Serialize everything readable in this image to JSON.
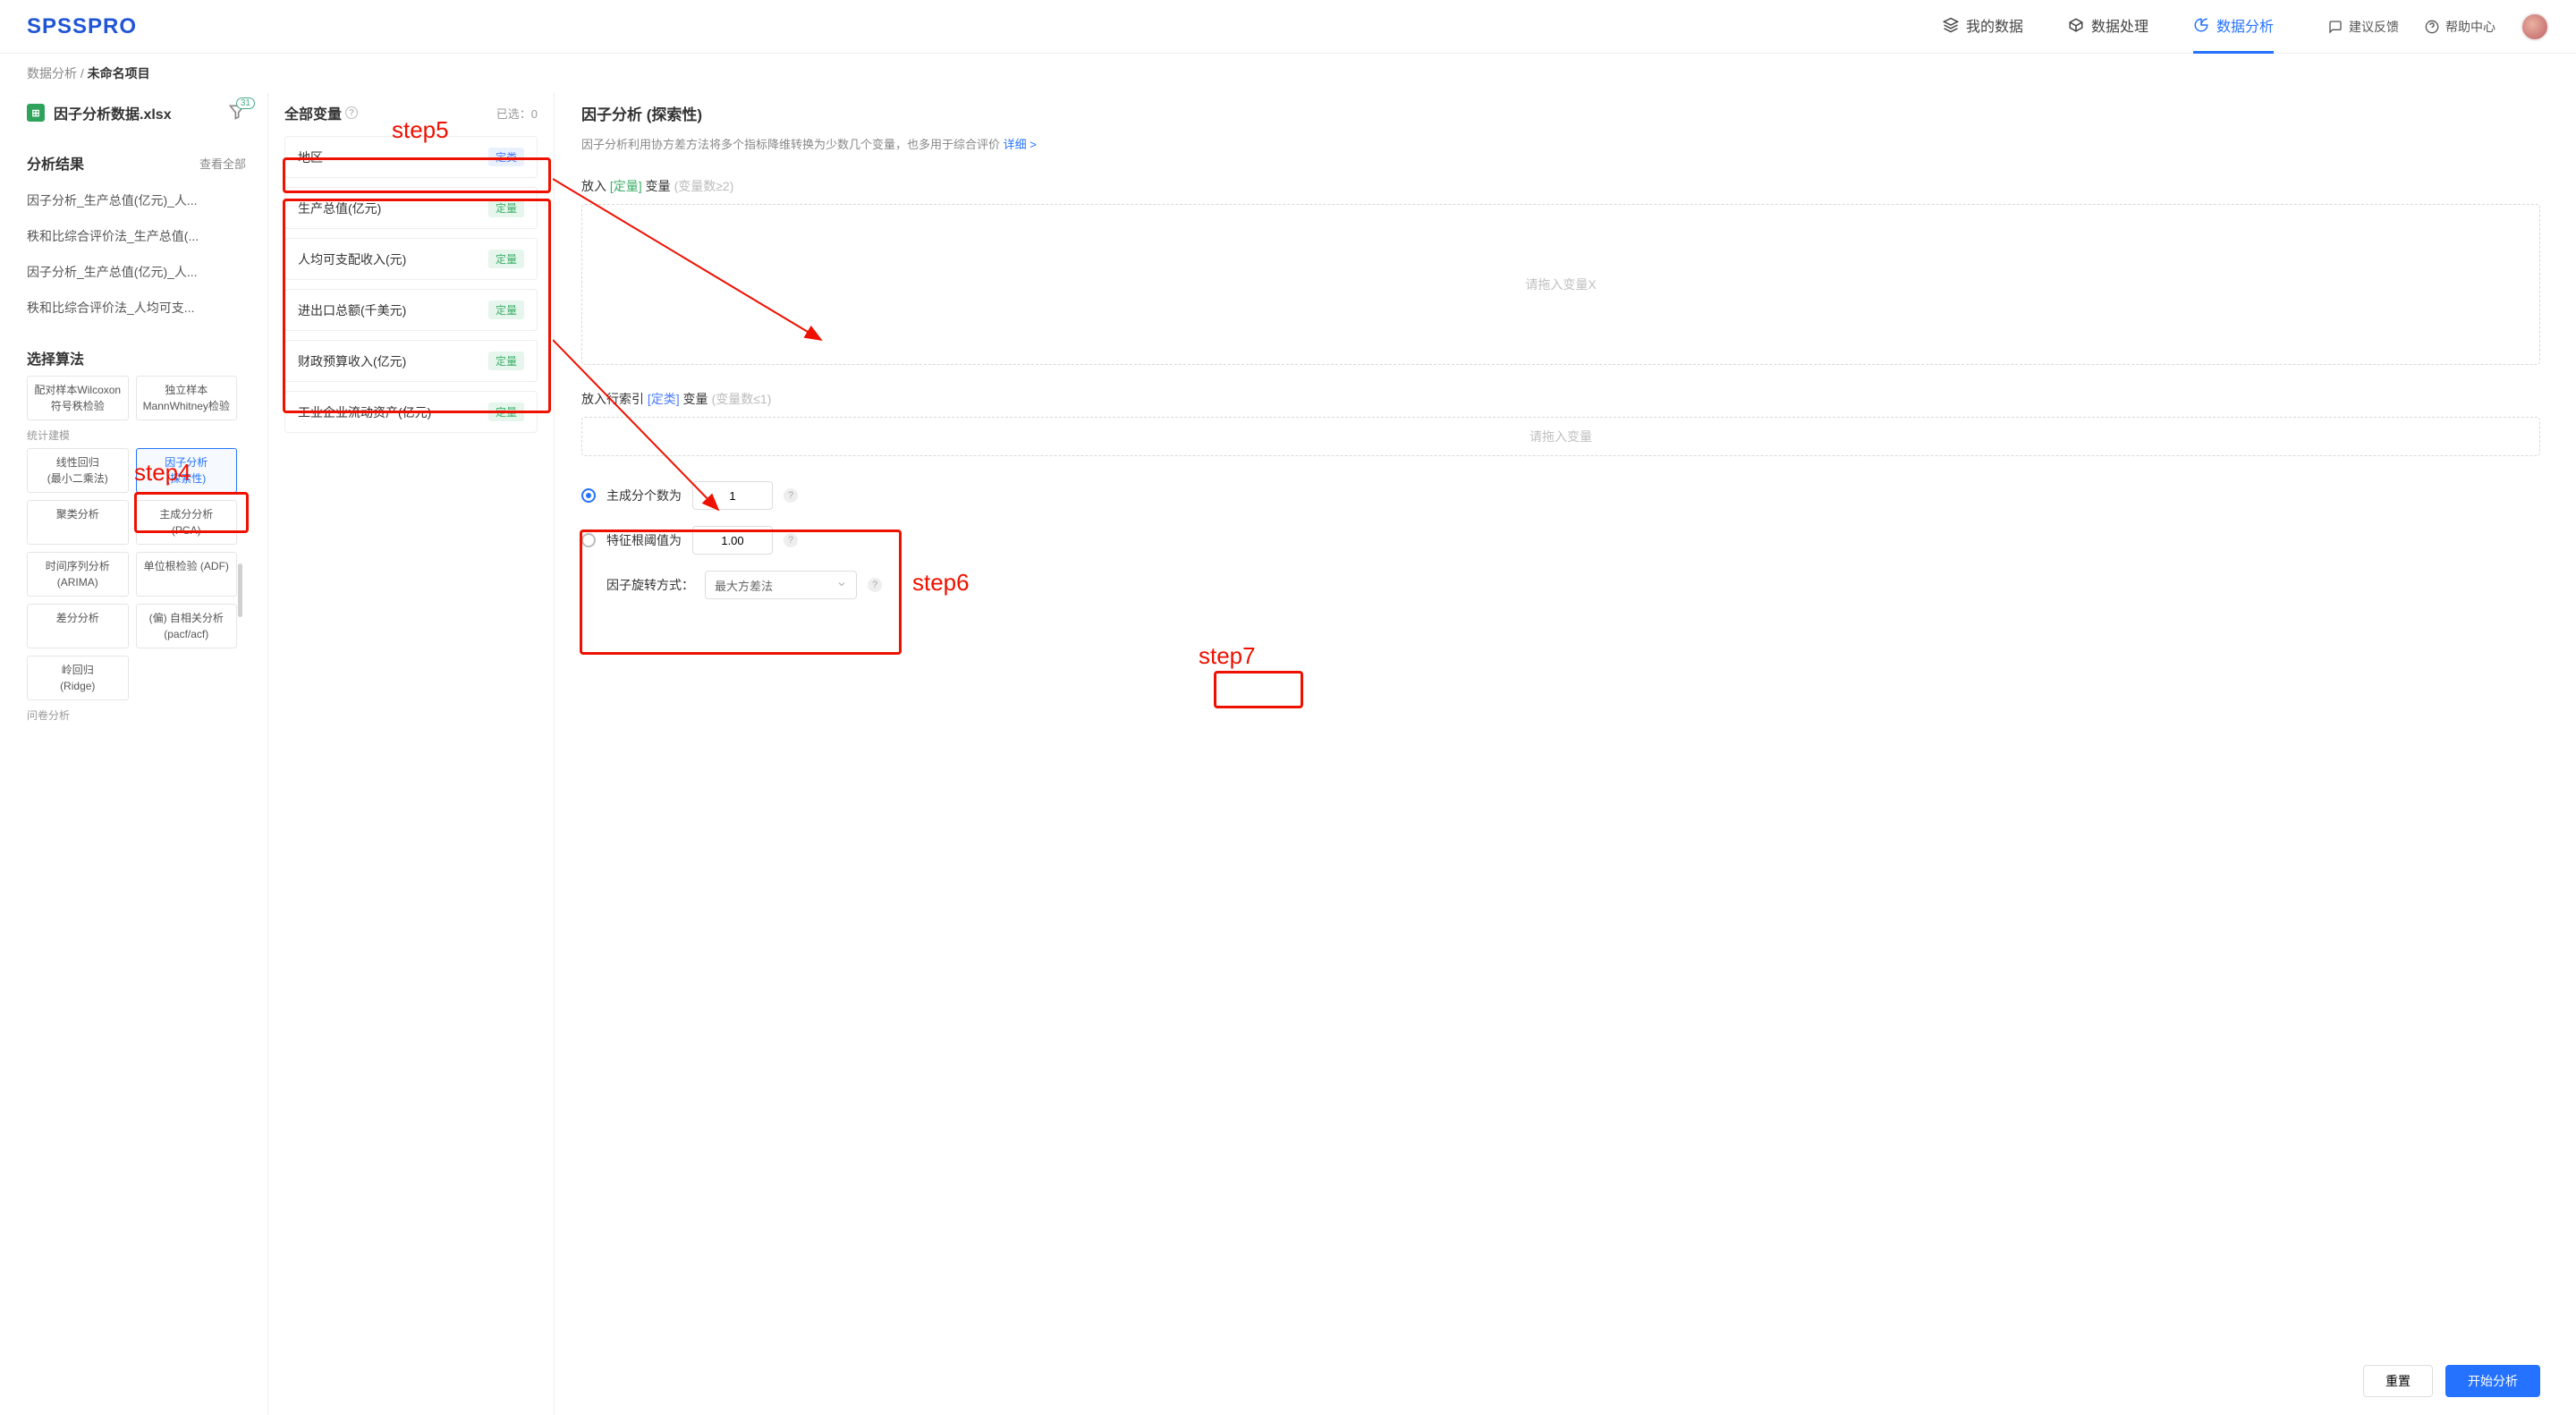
{
  "brand": "SPSSPRO",
  "top_nav": {
    "my_data": "我的数据",
    "data_process": "数据处理",
    "data_analysis": "数据分析",
    "feedback": "建议反馈",
    "help": "帮助中心"
  },
  "breadcrumb": {
    "root": "数据分析",
    "sep": " / ",
    "current": "未命名项目"
  },
  "file": {
    "name": "因子分析数据.xlsx",
    "filter_count": "31"
  },
  "left": {
    "results_title": "分析结果",
    "results_view_all": "查看全部",
    "results": [
      "因子分析_生产总值(亿元)_人...",
      "秩和比综合评价法_生产总值(...",
      "因子分析_生产总值(亿元)_人...",
      "秩和比综合评价法_人均可支..."
    ],
    "algo_title": "选择算法",
    "cat_stat": "统计建模",
    "cat_survey": "问卷分析",
    "algos_top": [
      {
        "l1": "配对样本Wilcoxon",
        "l2": "符号秩检验"
      },
      {
        "l1": "独立样本",
        "l2": "MannWhitney检验"
      }
    ],
    "algos_grid": [
      {
        "l1": "线性回归",
        "l2": "(最小二乘法)"
      },
      {
        "l1": "因子分析",
        "l2": "(探索性)",
        "active": true
      },
      {
        "l1": "聚类分析",
        "l2": ""
      },
      {
        "l1": "主成分分析",
        "l2": "(PCA)"
      },
      {
        "l1": "时间序列分析",
        "l2": "(ARIMA)"
      },
      {
        "l1": "单位根检验 (ADF)",
        "l2": ""
      },
      {
        "l1": "差分分析",
        "l2": ""
      },
      {
        "l1": "(偏) 自相关分析",
        "l2": "(pacf/acf)"
      },
      {
        "l1": "岭回归",
        "l2": "(Ridge)"
      },
      {
        "l1": "",
        "l2": ""
      }
    ]
  },
  "mid": {
    "title": "全部变量",
    "selected_prefix": "已选：",
    "selected_count": "0",
    "vars": [
      {
        "name": "地区",
        "type": "定类",
        "type_class": "qual"
      },
      {
        "name": "生产总值(亿元)",
        "type": "定量",
        "type_class": "quan"
      },
      {
        "name": "人均可支配收入(元)",
        "type": "定量",
        "type_class": "quan"
      },
      {
        "name": "进出口总额(千美元)",
        "type": "定量",
        "type_class": "quan"
      },
      {
        "name": "财政预算收入(亿元)",
        "type": "定量",
        "type_class": "quan"
      },
      {
        "name": "工业企业流动资产(亿元)",
        "type": "定量",
        "type_class": "quan"
      }
    ]
  },
  "right": {
    "title": "因子分析 (探索性)",
    "desc": "因子分析利用协方差方法将多个指标降维转换为少数几个变量，也多用于综合评价 ",
    "desc_link": "详细 >",
    "drop1_pre": "放入 ",
    "drop1_type": "[定量]",
    "drop1_post": " 变量",
    "drop1_hint": "(变量数≥2)",
    "drop1_placeholder": "请拖入变量X",
    "drop2_pre": "放入行索引 ",
    "drop2_type": "[定类]",
    "drop2_post": " 变量",
    "drop2_hint": "(变量数≤1)",
    "drop2_placeholder": "请拖入变量",
    "opt_pc_label": "主成分个数为",
    "opt_pc_value": "1",
    "opt_eig_label": "特征根阈值为",
    "opt_eig_value": "1.00",
    "opt_rot_label": "因子旋转方式：",
    "opt_rot_value": "最大方差法",
    "btn_reset": "重置",
    "btn_start": "开始分析"
  },
  "anno": {
    "step4": "step4",
    "step5": "step5",
    "step6": "step6",
    "step7": "step7"
  }
}
